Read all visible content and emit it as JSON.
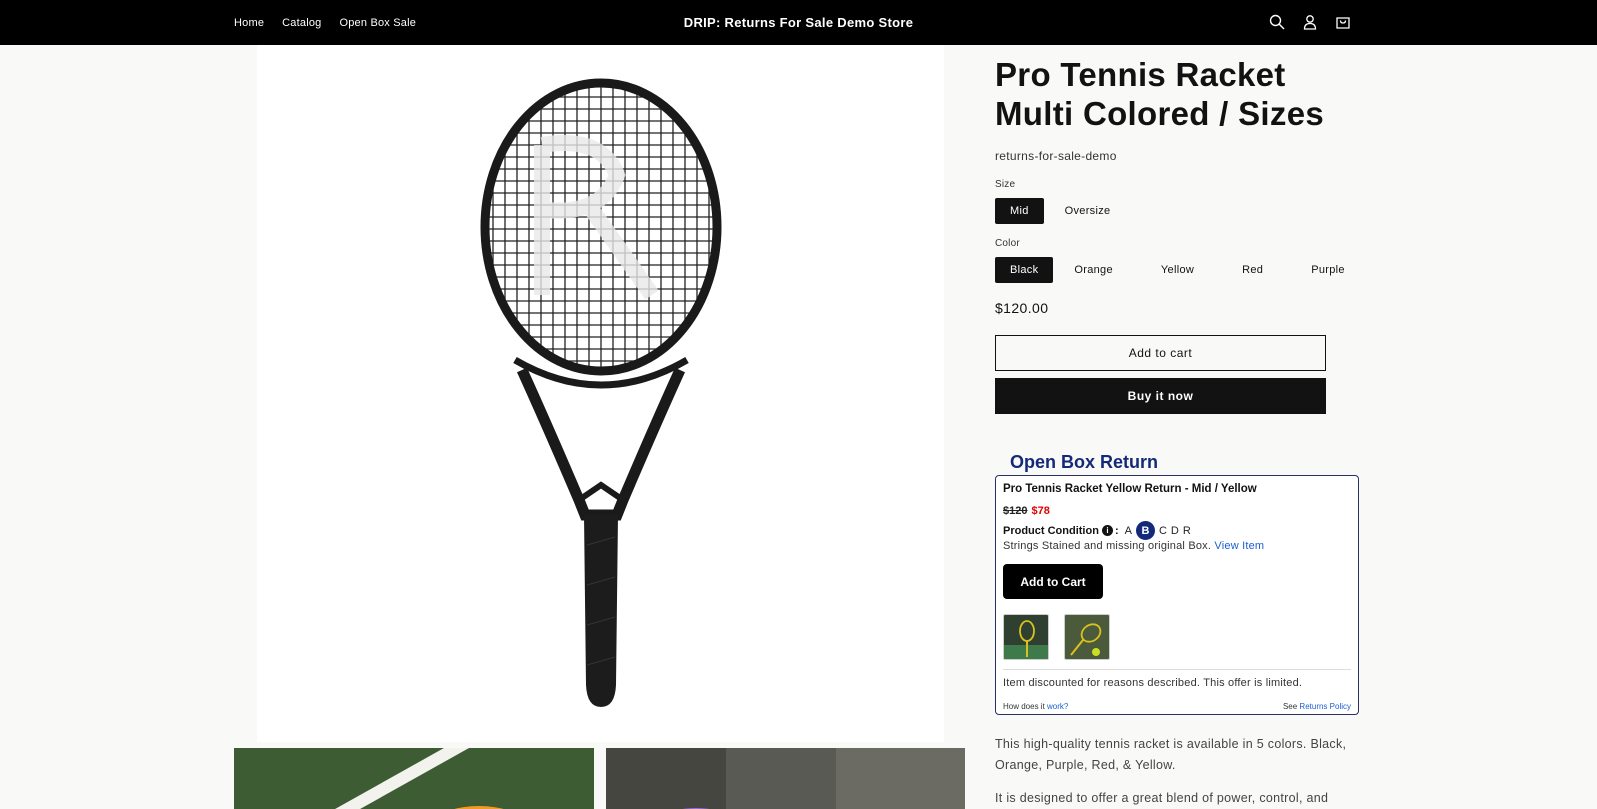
{
  "header": {
    "nav": [
      "Home",
      "Catalog",
      "Open Box Sale"
    ],
    "store_name": "DRIP: Returns For Sale Demo Store",
    "icons": [
      "search-icon",
      "account-icon",
      "cart-icon"
    ]
  },
  "product": {
    "title": "Pro Tennis Racket Multi Colored / Sizes",
    "vendor": "returns-for-sale-demo",
    "size_label": "Size",
    "sizes": [
      "Mid",
      "Oversize"
    ],
    "selected_size": "Mid",
    "color_label": "Color",
    "colors": [
      "Black",
      "Orange",
      "Yellow",
      "Red",
      "Purple"
    ],
    "selected_color": "Black",
    "price": "$120.00",
    "add_to_cart": "Add to cart",
    "buy_now": "Buy it now"
  },
  "open_box": {
    "heading": "Open Box Return",
    "item_title": "Pro Tennis Racket Yellow Return - Mid / Yellow",
    "old_price": "$120",
    "new_price": "$78",
    "condition_label": "Product Condition",
    "grades": [
      "A",
      "B",
      "C",
      "D",
      "R"
    ],
    "selected_grade": "B",
    "description": "Strings Stained and missing original Box.",
    "view_item": "View Item",
    "add_to_cart": "Add to Cart",
    "note": "Item discounted for reasons described. This offer is limited.",
    "how_prefix": "How does it",
    "how_link": "work?",
    "see_prefix": "See",
    "policy_link": "Returns Policy"
  },
  "description": [
    "This high-quality tennis racket is available in 5 colors.  Black, Orange, Purple, Red, & Yellow.",
    "It is designed to offer a great blend of power, control, and"
  ],
  "colors": {
    "accent": "#14297a",
    "sale": "#e00000",
    "link": "#1a5fd1",
    "header_bg": "#000000"
  }
}
